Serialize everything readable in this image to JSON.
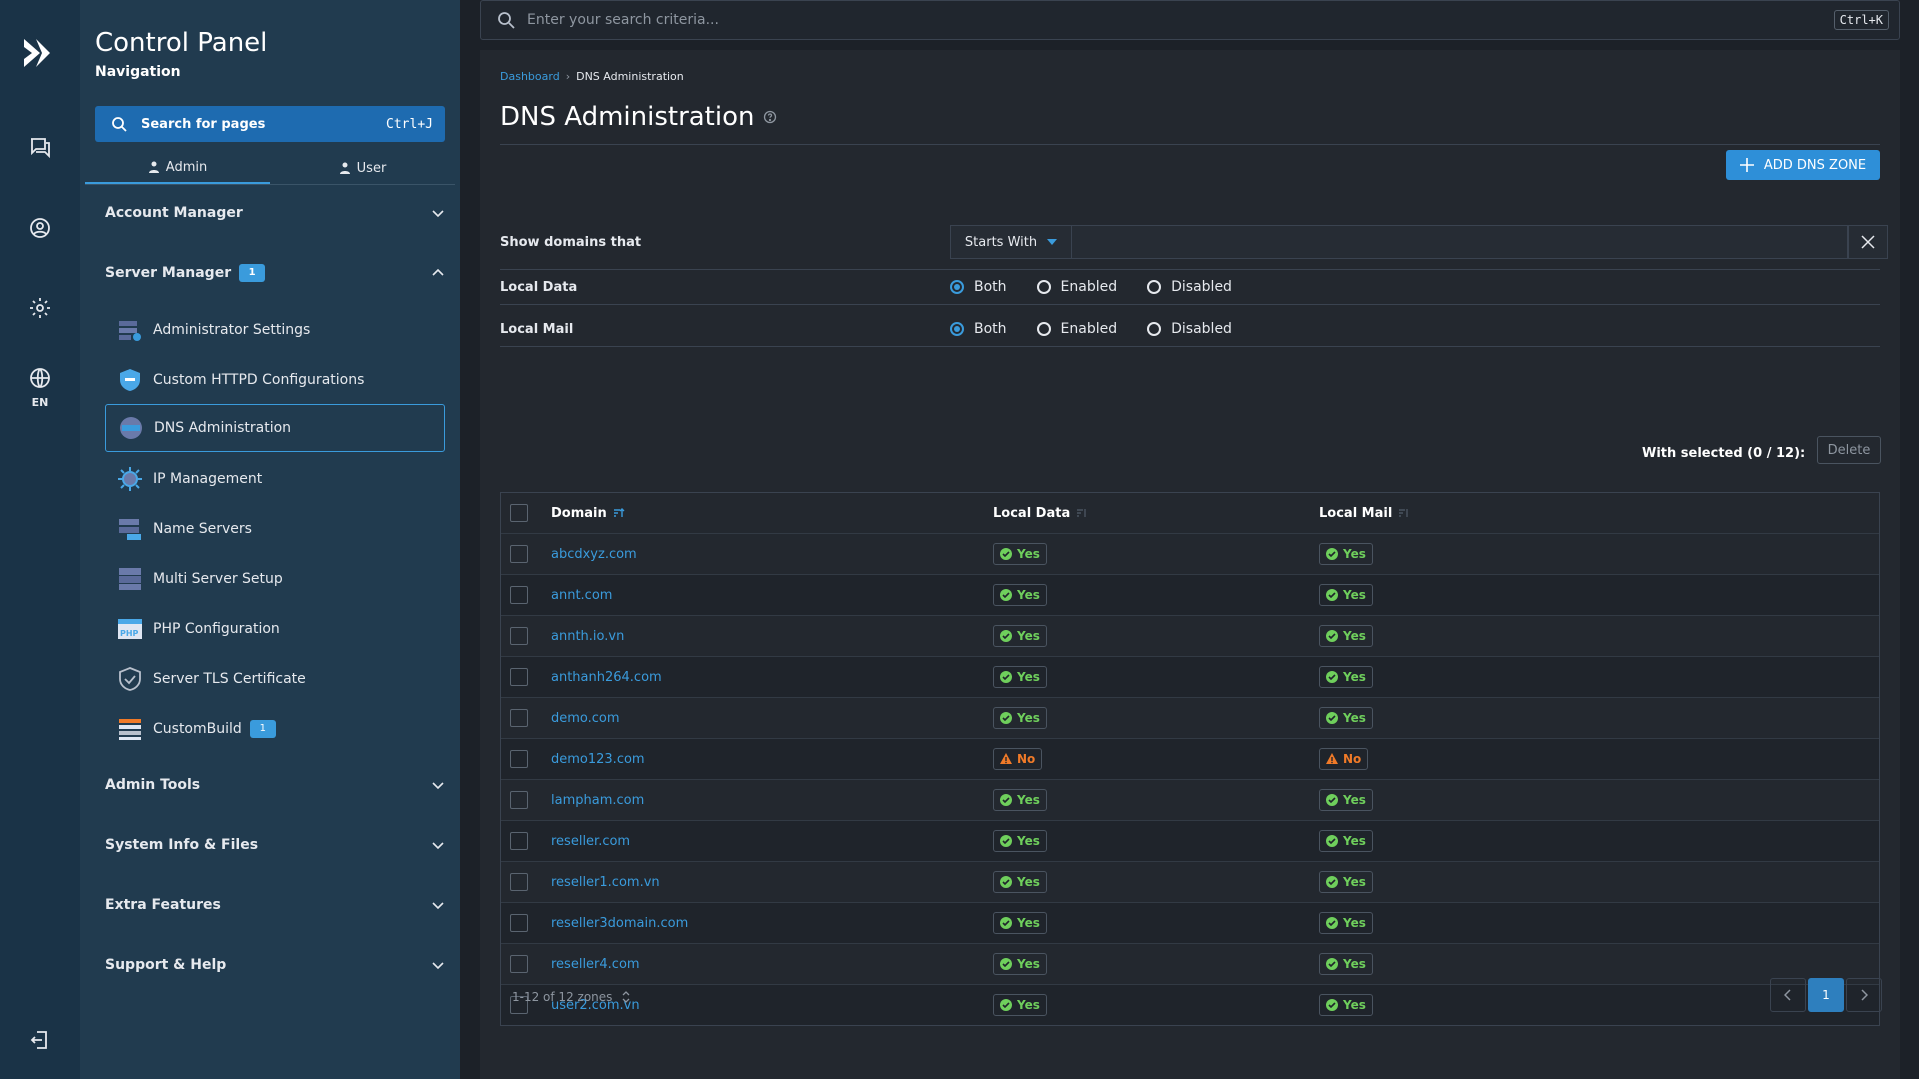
{
  "rail": {
    "lang": "EN",
    "icons": [
      "logo-icon",
      "chat-icon",
      "user-circle-icon",
      "gear-icon",
      "globe-icon",
      "logout-icon"
    ]
  },
  "sidebar": {
    "title": "Control Panel",
    "subtitle": "Navigation",
    "search_label": "Search for pages",
    "search_kbd": "Ctrl+J",
    "tabs": [
      {
        "label": "Admin"
      },
      {
        "label": "User"
      }
    ],
    "sections": {
      "account_manager": "Account Manager",
      "server_manager": "Server Manager",
      "server_manager_badge": "1",
      "admin_tools": "Admin Tools",
      "system_info": "System Info & Files",
      "extra_features": "Extra Features",
      "support": "Support & Help"
    },
    "items": [
      {
        "label": "Administrator Settings"
      },
      {
        "label": "Custom HTTPD Configurations"
      },
      {
        "label": "DNS Administration"
      },
      {
        "label": "IP Management"
      },
      {
        "label": "Name Servers"
      },
      {
        "label": "Multi Server Setup"
      },
      {
        "label": "PHP Configuration"
      },
      {
        "label": "Server TLS Certificate"
      },
      {
        "label": "CustomBuild",
        "badge": "1"
      }
    ]
  },
  "topbar": {
    "search_placeholder": "Enter your search criteria...",
    "kbd": "Ctrl+K"
  },
  "main": {
    "breadcrumb": {
      "home": "Dashboard",
      "current": "DNS Administration"
    },
    "title": "DNS Administration",
    "add_button": "ADD DNS ZONE",
    "filter": {
      "label": "Show domains that",
      "mode": "Starts With",
      "value": ""
    },
    "local_data": {
      "label": "Local Data",
      "options": [
        "Both",
        "Enabled",
        "Disabled"
      ],
      "selected": "Both"
    },
    "local_mail": {
      "label": "Local Mail",
      "options": [
        "Both",
        "Enabled",
        "Disabled"
      ],
      "selected": "Both"
    },
    "with_selected": "With selected (0 / 12):",
    "delete_button": "Delete",
    "table": {
      "columns": [
        "Domain",
        "Local Data",
        "Local Mail"
      ],
      "rows": [
        {
          "domain": "abcdxyz.com",
          "local_data": "Yes",
          "local_mail": "Yes"
        },
        {
          "domain": "annt.com",
          "local_data": "Yes",
          "local_mail": "Yes"
        },
        {
          "domain": "annth.io.vn",
          "local_data": "Yes",
          "local_mail": "Yes"
        },
        {
          "domain": "anthanh264.com",
          "local_data": "Yes",
          "local_mail": "Yes"
        },
        {
          "domain": "demo.com",
          "local_data": "Yes",
          "local_mail": "Yes"
        },
        {
          "domain": "demo123.com",
          "local_data": "No",
          "local_mail": "No"
        },
        {
          "domain": "lampham.com",
          "local_data": "Yes",
          "local_mail": "Yes"
        },
        {
          "domain": "reseller.com",
          "local_data": "Yes",
          "local_mail": "Yes"
        },
        {
          "domain": "reseller1.com.vn",
          "local_data": "Yes",
          "local_mail": "Yes"
        },
        {
          "domain": "reseller3domain.com",
          "local_data": "Yes",
          "local_mail": "Yes"
        },
        {
          "domain": "reseller4.com",
          "local_data": "Yes",
          "local_mail": "Yes"
        },
        {
          "domain": "user2.com.vn",
          "local_data": "Yes",
          "local_mail": "Yes"
        }
      ]
    },
    "pagination": {
      "summary": "1-12 of 12 zones",
      "current_page": "1"
    }
  },
  "colors": {
    "accent": "#3a9bdc",
    "yes": "#6fcf5c",
    "no": "#f07a28"
  }
}
